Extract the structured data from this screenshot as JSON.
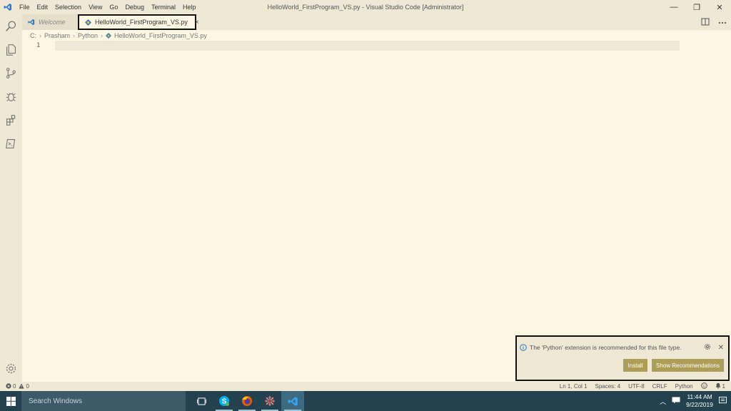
{
  "titlebar": {
    "title": "HelloWorld_FirstProgram_VS.py - Visual Studio Code [Administrator]",
    "menu": [
      "File",
      "Edit",
      "Selection",
      "View",
      "Go",
      "Debug",
      "Terminal",
      "Help"
    ],
    "controls": {
      "minimize": "—",
      "restore": "❐",
      "close": "✕"
    }
  },
  "activitybar": {
    "icons": [
      "explorer-search-icon",
      "files-icon",
      "source-control-icon",
      "debug-icon",
      "extensions-icon",
      "remote-icon"
    ],
    "settings": "gear-icon"
  },
  "tabs": [
    {
      "label": "Welcome",
      "active": false
    },
    {
      "label": "HelloWorld_FirstProgram_VS.py",
      "active": true,
      "close": "×"
    }
  ],
  "breadcrumb": [
    "C:",
    "Prasham",
    "Python",
    "HelloWorld_FirstProgram_VS.py"
  ],
  "editor": {
    "line_numbers": [
      "1"
    ]
  },
  "notification": {
    "message": "The 'Python' extension is recommended for this file type.",
    "install_label": "Install",
    "show_label": "Show Recommendations"
  },
  "statusbar": {
    "errors": "0",
    "warnings": "0",
    "position": "Ln 1, Col 1",
    "spaces": "Spaces: 4",
    "encoding": "UTF-8",
    "eol": "CRLF",
    "language": "Python",
    "notifications": "1"
  },
  "taskbar": {
    "search_placeholder": "Search Windows",
    "time": "11:44 AM",
    "date": "9/22/2019"
  },
  "colors": {
    "editor_bg": "#fdf6e3",
    "chrome_bg": "#eee8d5",
    "button_bg": "#ac9d57",
    "taskbar_bg": "#23414f"
  }
}
